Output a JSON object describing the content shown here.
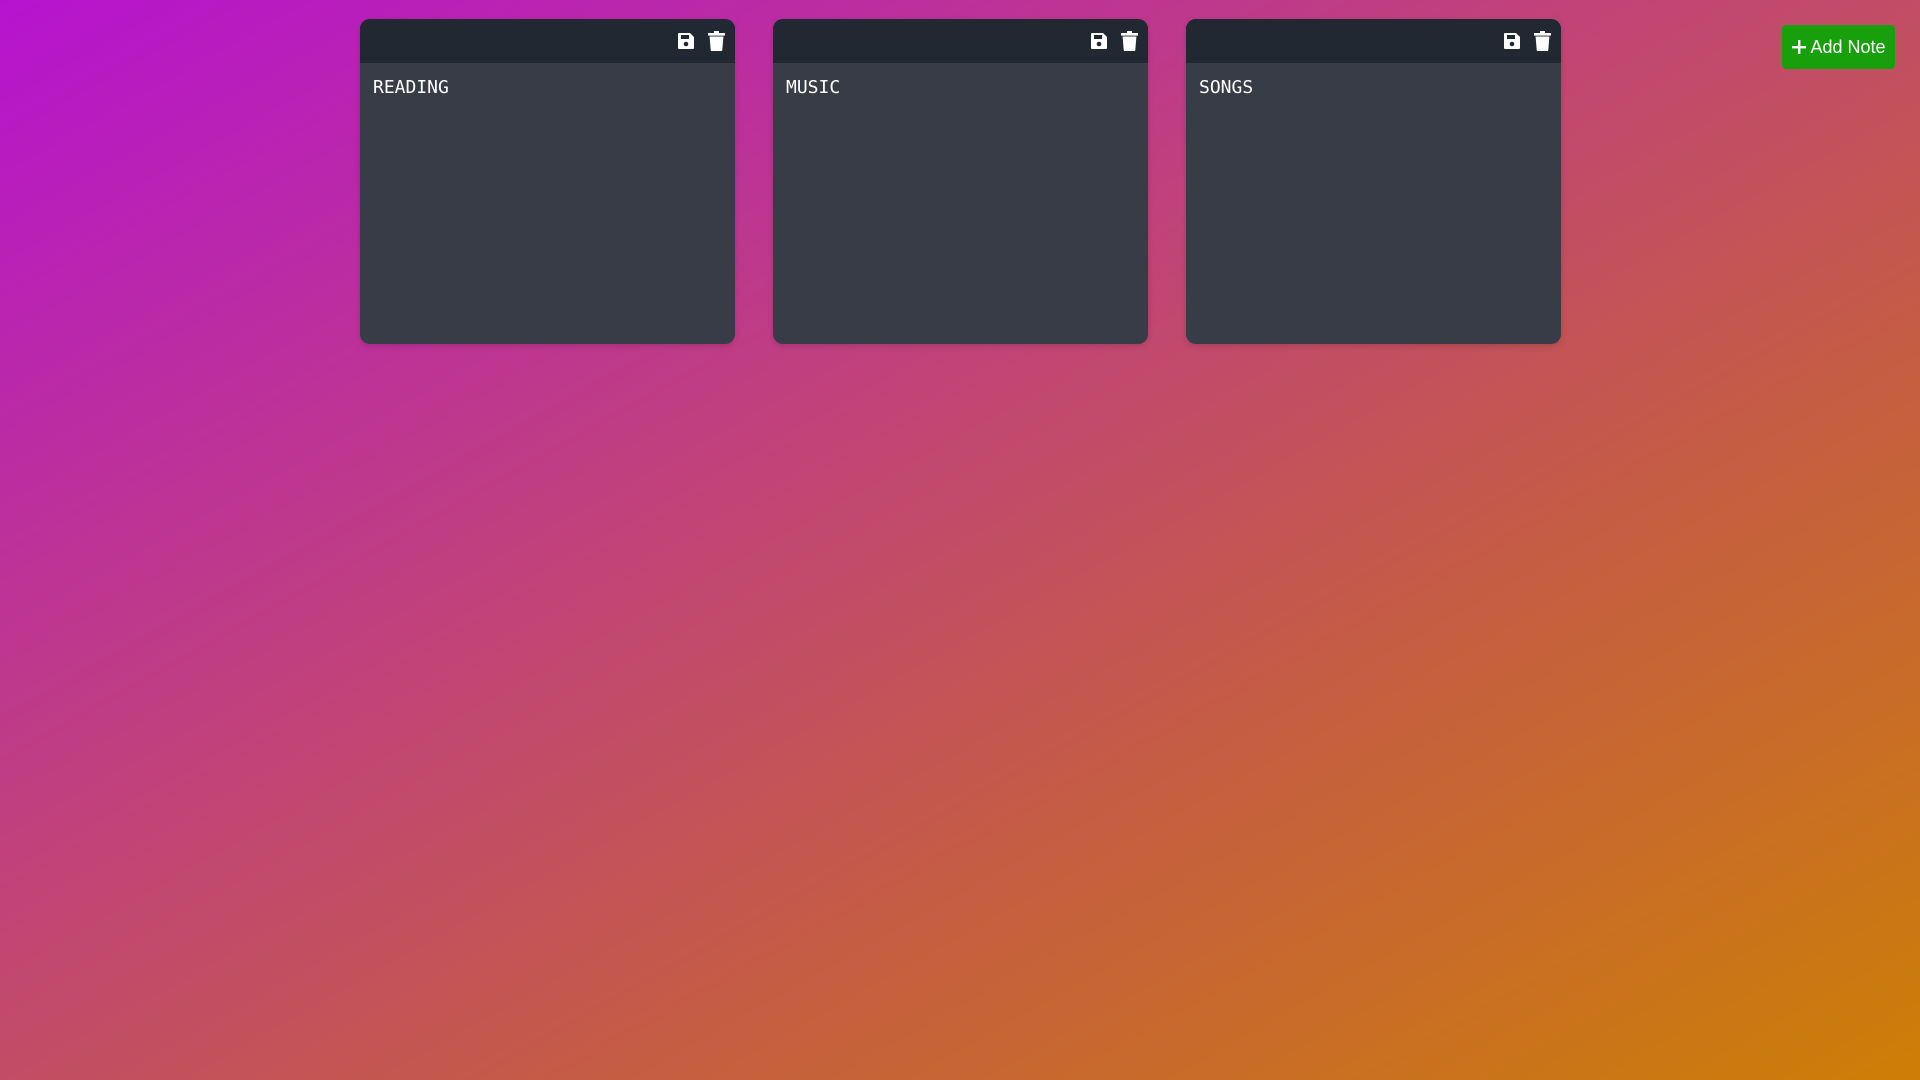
{
  "toolbar": {
    "add_note_label": "Add Note",
    "add_icon": "plus-icon"
  },
  "notes": [
    {
      "text": "READING",
      "save_icon": "save-icon",
      "delete_icon": "trash-icon"
    },
    {
      "text": "MUSIC",
      "save_icon": "save-icon",
      "delete_icon": "trash-icon"
    },
    {
      "text": "SONGS",
      "save_icon": "save-icon",
      "delete_icon": "trash-icon"
    }
  ],
  "colors": {
    "add_button": "#17a00c",
    "note_header": "#222831",
    "note_body": "#383c47",
    "gradient_start": "#b613cf",
    "gradient_end": "#cc7f06"
  }
}
